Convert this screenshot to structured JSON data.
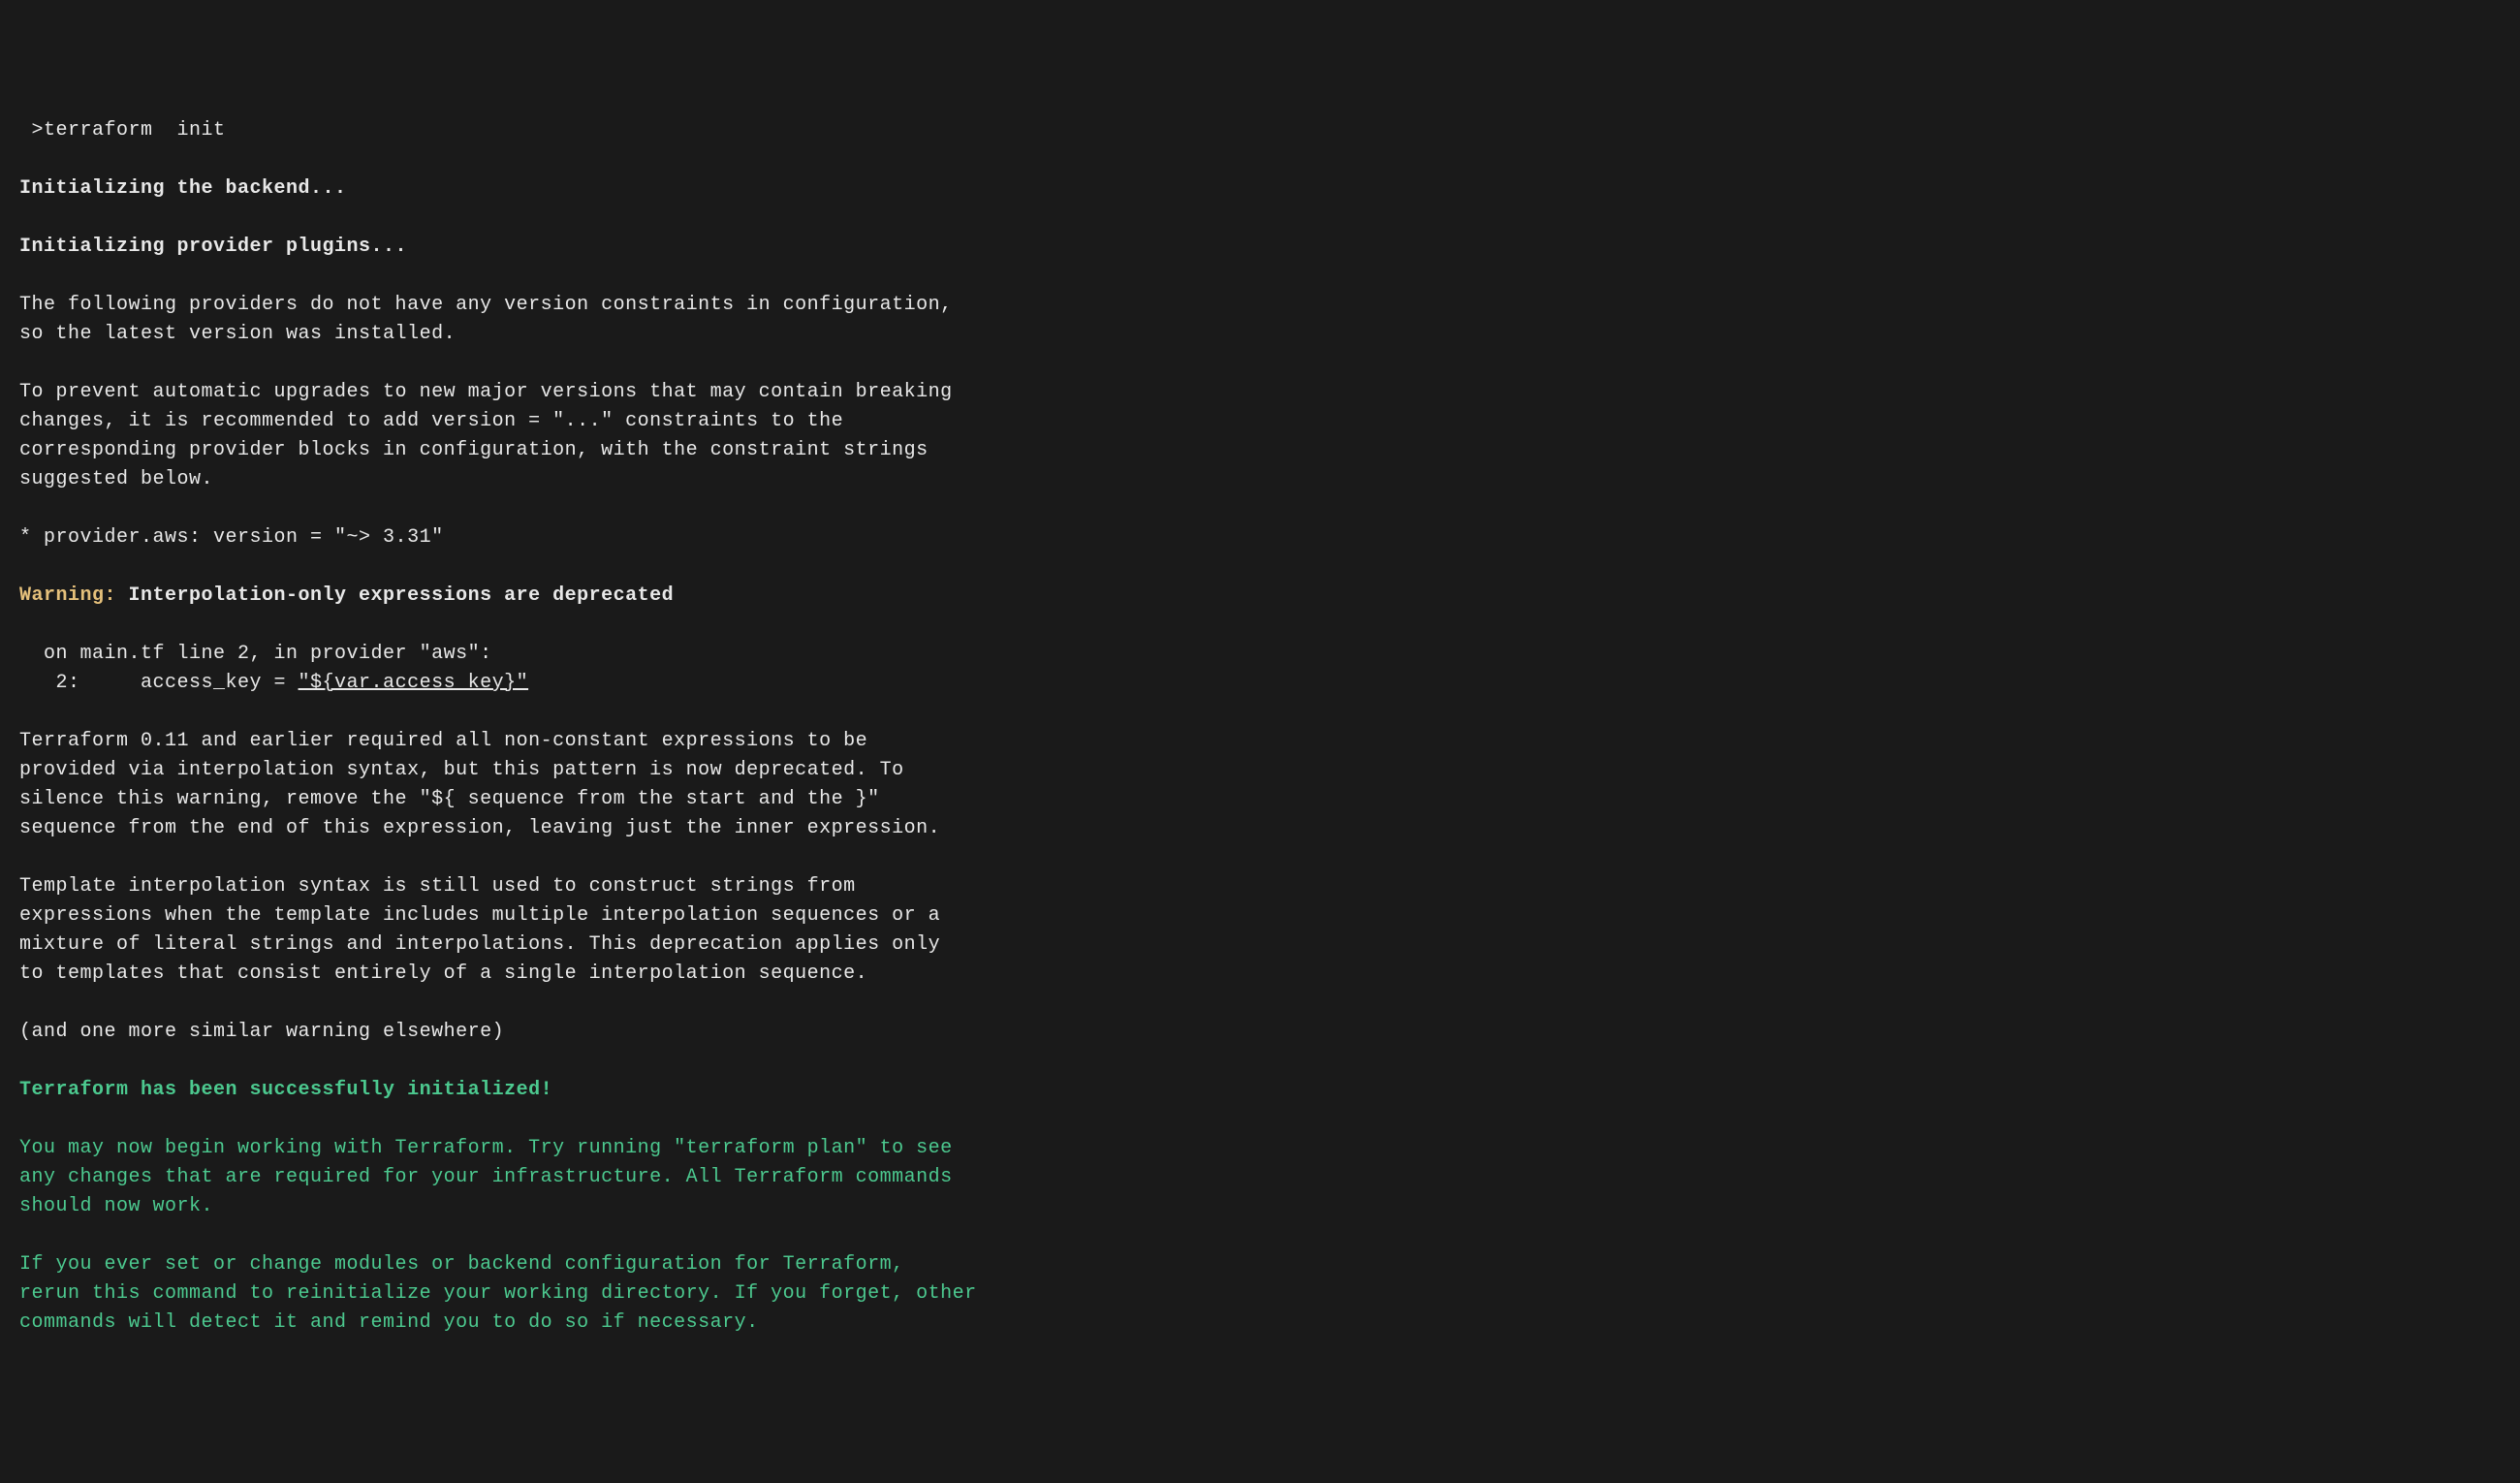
{
  "prompt": " >terraform  init",
  "init_backend": "Initializing the backend...",
  "init_plugins": "Initializing provider plugins...",
  "no_version": "The following providers do not have any version constraints in configuration,\nso the latest version was installed.",
  "prevent_upgrades": "To prevent automatic upgrades to new major versions that may contain breaking\nchanges, it is recommended to add version = \"...\" constraints to the\ncorresponding provider blocks in configuration, with the constraint strings\nsuggested below.",
  "provider_line": "* provider.aws: version = \"~> 3.31\"",
  "warning_label": "Warning:",
  "warning_msg": " Interpolation-only expressions are deprecated",
  "warning_loc1": "  on main.tf line 2, in provider \"aws\":",
  "warning_loc2a": "   2:     access_key = ",
  "warning_loc2b": "\"${var.access_key}\"",
  "deprecation_para1": "Terraform 0.11 and earlier required all non-constant expressions to be\nprovided via interpolation syntax, but this pattern is now deprecated. To\nsilence this warning, remove the \"${ sequence from the start and the }\"\nsequence from the end of this expression, leaving just the inner expression.",
  "deprecation_para2": "Template interpolation syntax is still used to construct strings from\nexpressions when the template includes multiple interpolation sequences or a\nmixture of literal strings and interpolations. This deprecation applies only\nto templates that consist entirely of a single interpolation sequence.",
  "more_warnings": "(and one more similar warning elsewhere)",
  "success_msg": "Terraform has been successfully initialized!",
  "success_para1": "You may now begin working with Terraform. Try running \"terraform plan\" to see\nany changes that are required for your infrastructure. All Terraform commands\nshould now work.",
  "success_para2": "If you ever set or change modules or backend configuration for Terraform,\nrerun this command to reinitialize your working directory. If you forget, other\ncommands will detect it and remind you to do so if necessary."
}
